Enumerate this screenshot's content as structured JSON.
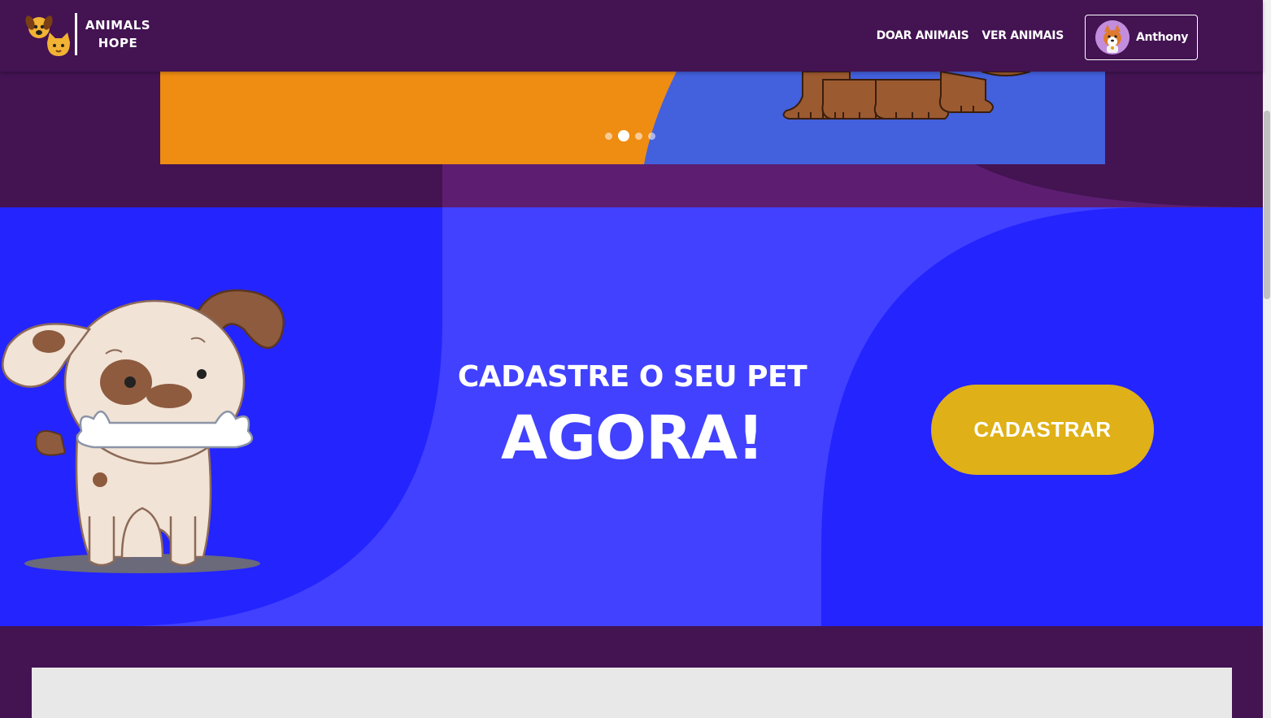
{
  "brand": {
    "line1": "ANIMALS",
    "line2": "HOPE"
  },
  "nav": {
    "links": [
      {
        "label": "DOAR ANIMAIS"
      },
      {
        "label": "VER ANIMAIS"
      }
    ],
    "user": {
      "name": "Anthony",
      "avatar_icon": "corgi-avatar-icon"
    }
  },
  "carousel": {
    "slide_count": 4,
    "active_index": 1,
    "colors": {
      "left": "#ef8c12",
      "right": "#4360dd"
    }
  },
  "hero": {
    "line1": "CADASTRE O SEU PET",
    "line2": "AGORA!",
    "button_label": "CADASTRAR",
    "colors": {
      "background": "#2424ff",
      "center_panel": "#4141ff",
      "button": "#dfb017"
    }
  },
  "colors": {
    "page_background": "#431352",
    "strip": "#5d1e72"
  }
}
